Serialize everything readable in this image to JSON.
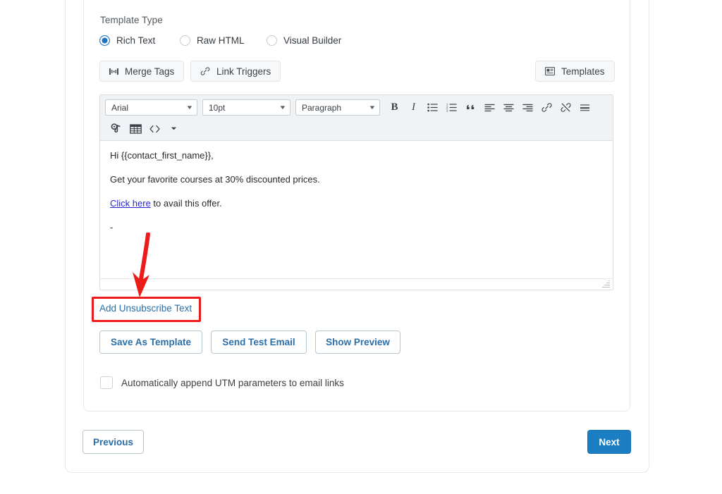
{
  "template_type": {
    "label": "Template Type",
    "options": [
      {
        "label": "Rich Text",
        "selected": true
      },
      {
        "label": "Raw HTML",
        "selected": false
      },
      {
        "label": "Visual Builder",
        "selected": false
      }
    ]
  },
  "chips": {
    "merge_tags": "Merge Tags",
    "link_triggers": "Link Triggers",
    "templates": "Templates"
  },
  "editor": {
    "font_family": "Arial",
    "font_size": "10pt",
    "format": "Paragraph",
    "toolbar_icons": [
      "bold-icon",
      "italic-icon",
      "bullet-list-icon",
      "numbered-list-icon",
      "blockquote-icon",
      "align-left-icon",
      "align-center-icon",
      "align-right-icon",
      "insert-link-icon",
      "unlink-icon",
      "horizontal-rule-icon",
      "insert-image-icon",
      "insert-table-icon",
      "source-code-icon",
      "more-options-icon"
    ],
    "body": {
      "line1": "Hi {{contact_first_name}},",
      "line2": "Get your favorite courses at 30% discounted prices.",
      "line3_link": "Click here",
      "line3_rest": " to avail this offer.",
      "line4": "-"
    }
  },
  "unsubscribe_link": "Add Unsubscribe Text",
  "buttons": {
    "save_as_template": "Save As Template",
    "send_test_email": "Send Test Email",
    "show_preview": "Show Preview"
  },
  "utm_checkbox": {
    "label": "Automatically append UTM parameters to email links",
    "checked": false
  },
  "navigation": {
    "previous": "Previous",
    "next": "Next"
  },
  "annotation": {
    "type": "red-arrow-and-box",
    "color": "#ee1b1b",
    "points_to": "Add Unsubscribe Text"
  },
  "colors": {
    "primary_blue": "#1b7ec2",
    "link_blue": "#2b6ea8",
    "annotation_red": "#ee1b1b",
    "toolbar_bg": "#eff3f5",
    "body_link": "#2727d6"
  }
}
